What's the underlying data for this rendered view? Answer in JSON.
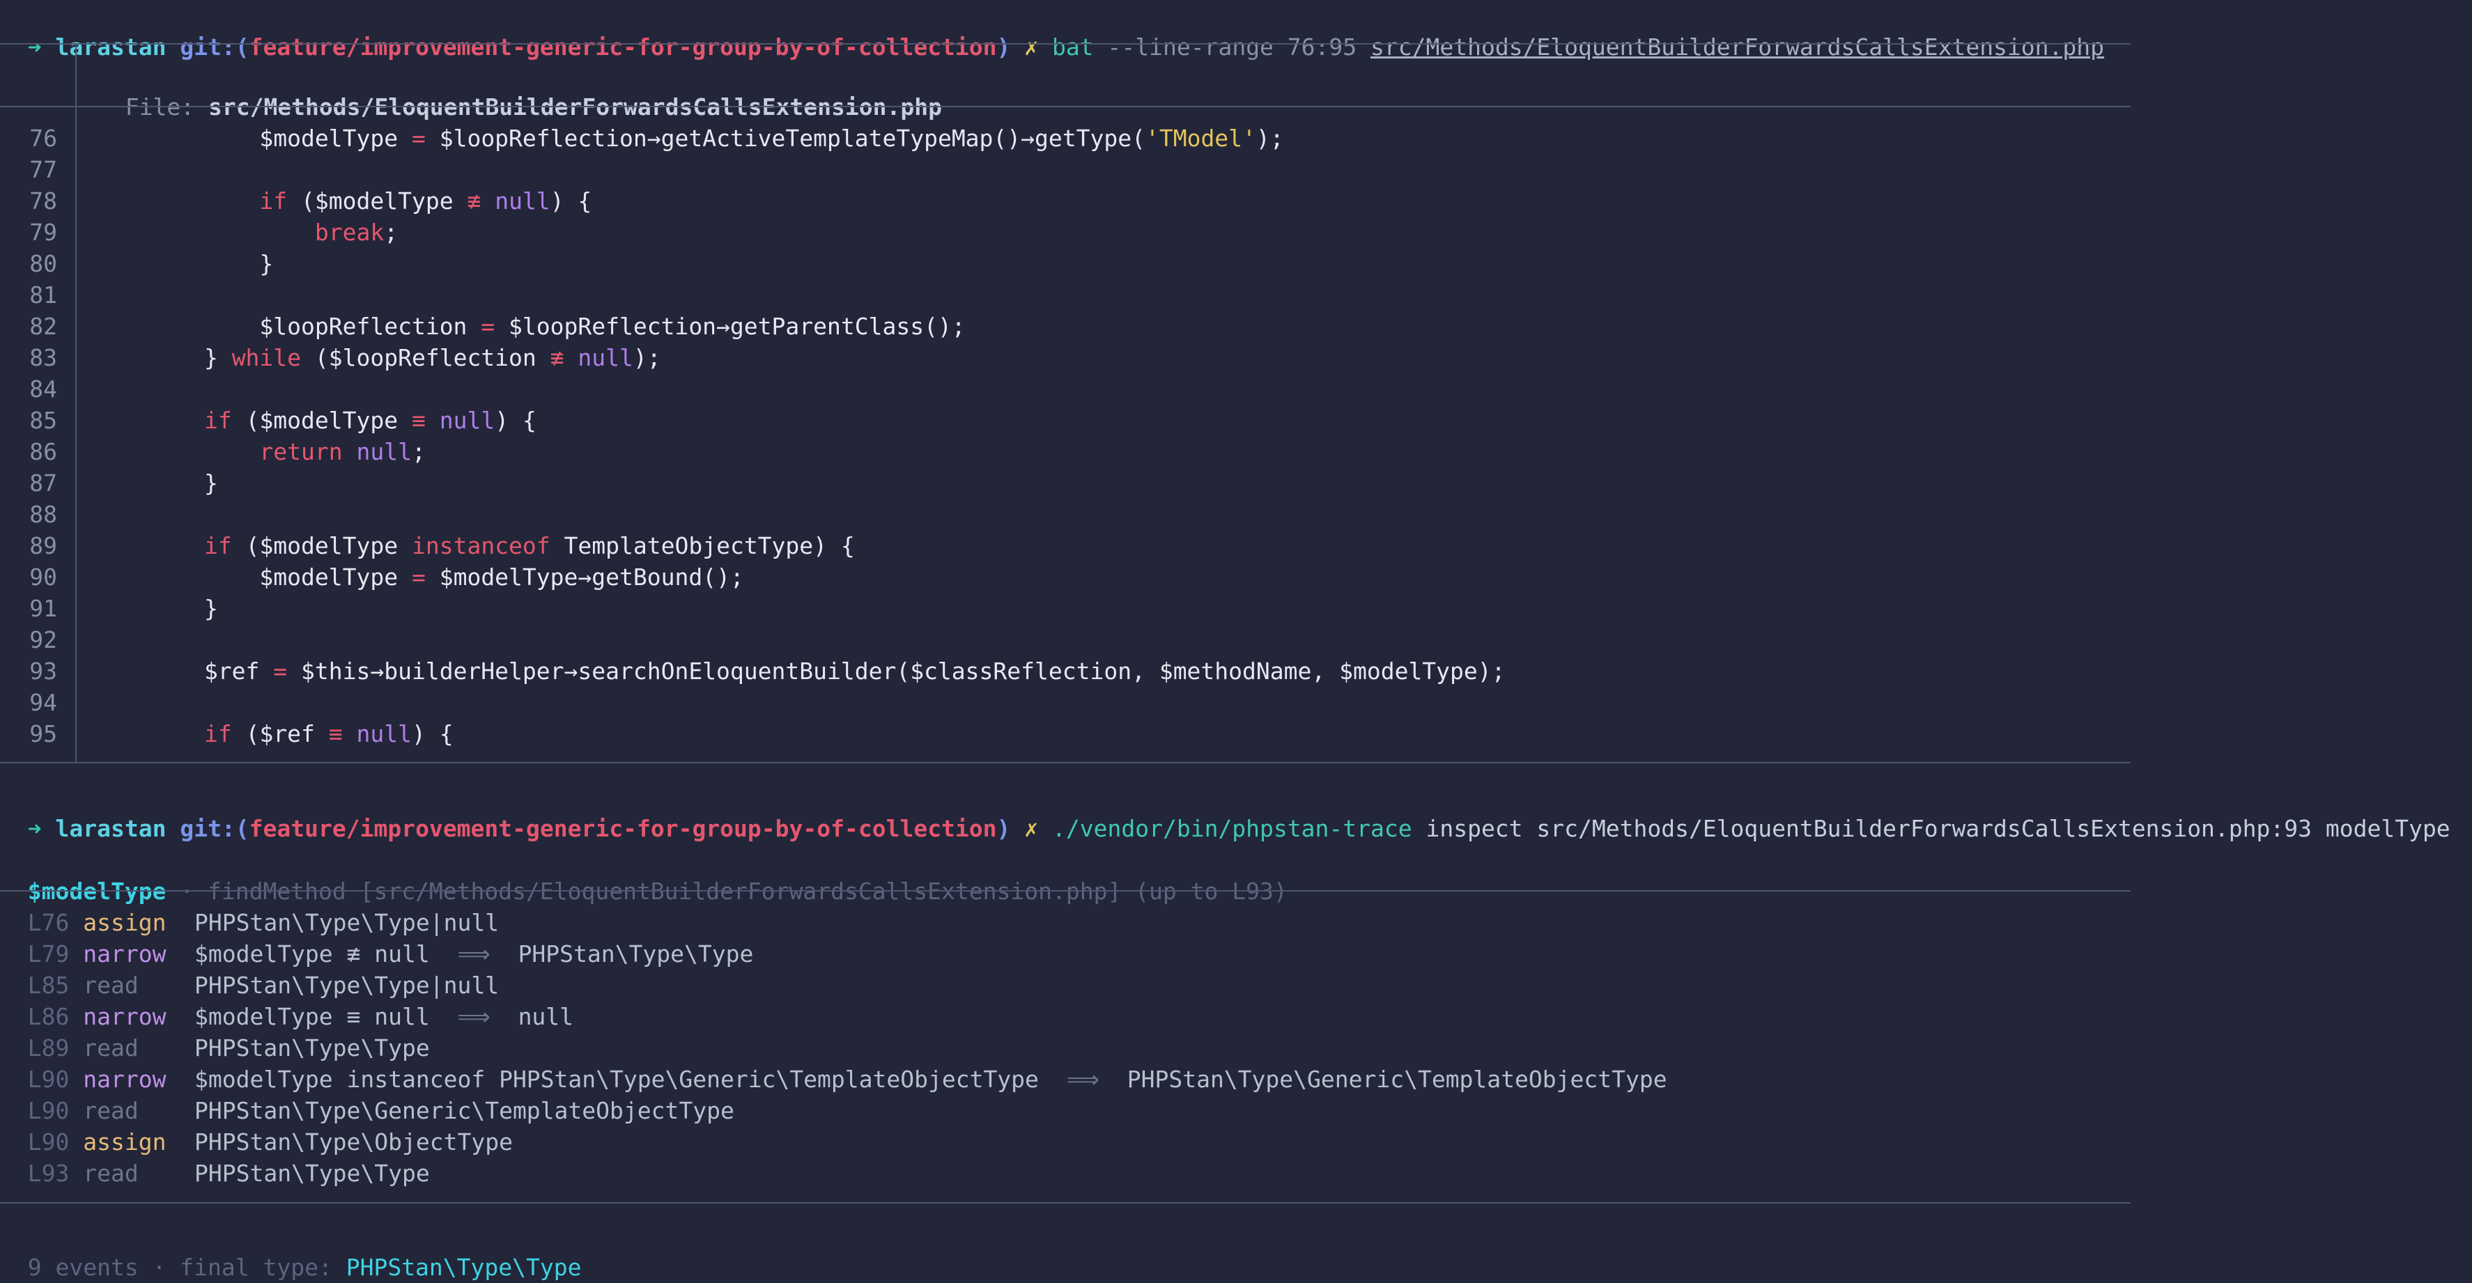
{
  "prompt1": {
    "arrow": "➜",
    "repo": "larastan",
    "git_prefix": "git:(",
    "branch": "feature/improvement-generic-for-group-by-of-collection",
    "git_suffix": ")",
    "dirty": "✗",
    "command": "bat",
    "options": "--line-range 76:95",
    "path": "src/Methods/EloquentBuilderForwardsCallsExtension.php"
  },
  "bat": {
    "file_label": "File: ",
    "file_name": "src/Methods/EloquentBuilderForwardsCallsExtension.php",
    "lines": [
      {
        "num": "76",
        "tokens": [
          {
            "t": "            $modelType ",
            "c": ""
          },
          {
            "t": "=",
            "c": "op"
          },
          {
            "t": " $loopReflection→getActiveTemplateTypeMap()→getType(",
            "c": ""
          },
          {
            "t": "'TModel'",
            "c": "str"
          },
          {
            "t": ");",
            "c": ""
          }
        ]
      },
      {
        "num": "77",
        "tokens": []
      },
      {
        "num": "78",
        "tokens": [
          {
            "t": "            ",
            "c": ""
          },
          {
            "t": "if",
            "c": "kw"
          },
          {
            "t": " ($modelType ",
            "c": ""
          },
          {
            "t": "≢",
            "c": "op"
          },
          {
            "t": " ",
            "c": ""
          },
          {
            "t": "null",
            "c": "lit"
          },
          {
            "t": ") {",
            "c": ""
          }
        ]
      },
      {
        "num": "79",
        "tokens": [
          {
            "t": "                ",
            "c": ""
          },
          {
            "t": "break",
            "c": "kw"
          },
          {
            "t": ";",
            "c": ""
          }
        ]
      },
      {
        "num": "80",
        "tokens": [
          {
            "t": "            }",
            "c": ""
          }
        ]
      },
      {
        "num": "81",
        "tokens": []
      },
      {
        "num": "82",
        "tokens": [
          {
            "t": "            $loopReflection ",
            "c": ""
          },
          {
            "t": "=",
            "c": "op"
          },
          {
            "t": " $loopReflection→getParentClass();",
            "c": ""
          }
        ]
      },
      {
        "num": "83",
        "tokens": [
          {
            "t": "        } ",
            "c": ""
          },
          {
            "t": "while",
            "c": "kw"
          },
          {
            "t": " ($loopReflection ",
            "c": ""
          },
          {
            "t": "≢",
            "c": "op"
          },
          {
            "t": " ",
            "c": ""
          },
          {
            "t": "null",
            "c": "lit"
          },
          {
            "t": ");",
            "c": ""
          }
        ]
      },
      {
        "num": "84",
        "tokens": []
      },
      {
        "num": "85",
        "tokens": [
          {
            "t": "        ",
            "c": ""
          },
          {
            "t": "if",
            "c": "kw"
          },
          {
            "t": " ($modelType ",
            "c": ""
          },
          {
            "t": "≡",
            "c": "op"
          },
          {
            "t": " ",
            "c": ""
          },
          {
            "t": "null",
            "c": "lit"
          },
          {
            "t": ") {",
            "c": ""
          }
        ]
      },
      {
        "num": "86",
        "tokens": [
          {
            "t": "            ",
            "c": ""
          },
          {
            "t": "return",
            "c": "kw"
          },
          {
            "t": " ",
            "c": ""
          },
          {
            "t": "null",
            "c": "lit"
          },
          {
            "t": ";",
            "c": ""
          }
        ]
      },
      {
        "num": "87",
        "tokens": [
          {
            "t": "        }",
            "c": ""
          }
        ]
      },
      {
        "num": "88",
        "tokens": []
      },
      {
        "num": "89",
        "tokens": [
          {
            "t": "        ",
            "c": ""
          },
          {
            "t": "if",
            "c": "kw"
          },
          {
            "t": " ($modelType ",
            "c": ""
          },
          {
            "t": "instanceof",
            "c": "kw"
          },
          {
            "t": " TemplateObjectType) {",
            "c": ""
          }
        ]
      },
      {
        "num": "90",
        "tokens": [
          {
            "t": "            $modelType ",
            "c": ""
          },
          {
            "t": "=",
            "c": "op"
          },
          {
            "t": " $modelType→getBound();",
            "c": ""
          }
        ]
      },
      {
        "num": "91",
        "tokens": [
          {
            "t": "        }",
            "c": ""
          }
        ]
      },
      {
        "num": "92",
        "tokens": []
      },
      {
        "num": "93",
        "tokens": [
          {
            "t": "        $ref ",
            "c": ""
          },
          {
            "t": "=",
            "c": "op"
          },
          {
            "t": " $this→builderHelper→searchOnEloquentBuilder($classReflection, $methodName, $modelType);",
            "c": ""
          }
        ]
      },
      {
        "num": "94",
        "tokens": []
      },
      {
        "num": "95",
        "tokens": [
          {
            "t": "        ",
            "c": ""
          },
          {
            "t": "if",
            "c": "kw"
          },
          {
            "t": " ($ref ",
            "c": ""
          },
          {
            "t": "≡",
            "c": "op"
          },
          {
            "t": " ",
            "c": ""
          },
          {
            "t": "null",
            "c": "lit"
          },
          {
            "t": ") {",
            "c": ""
          }
        ]
      }
    ]
  },
  "prompt2": {
    "arrow": "➜",
    "repo": "larastan",
    "git_prefix": "git:(",
    "branch": "feature/improvement-generic-for-group-by-of-collection",
    "git_suffix": ")",
    "dirty": "✗",
    "command": "./vendor/bin/phpstan-trace",
    "args": "inspect src/Methods/EloquentBuilderForwardsCallsExtension.php:93 modelType"
  },
  "trace": {
    "variable": "$modelType",
    "context": " · findMethod [src/Methods/EloquentBuilderForwardsCallsExtension.php] (up to L93)",
    "events": [
      {
        "line": "L76",
        "kind": "assign",
        "text": "PHPStan\\Type\\Type|null",
        "arrow": "",
        "result": ""
      },
      {
        "line": "L79",
        "kind": "narrow",
        "text": "$modelType ≢ null",
        "arrow": "⟹",
        "result": "PHPStan\\Type\\Type"
      },
      {
        "line": "L85",
        "kind": "read",
        "text": "PHPStan\\Type\\Type|null",
        "arrow": "",
        "result": ""
      },
      {
        "line": "L86",
        "kind": "narrow",
        "text": "$modelType ≡ null",
        "arrow": "⟹",
        "result": "null"
      },
      {
        "line": "L89",
        "kind": "read",
        "text": "PHPStan\\Type\\Type",
        "arrow": "",
        "result": ""
      },
      {
        "line": "L90",
        "kind": "narrow",
        "text": "$modelType instanceof PHPStan\\Type\\Generic\\TemplateObjectType",
        "arrow": "⟹",
        "result": "PHPStan\\Type\\Generic\\TemplateObjectType"
      },
      {
        "line": "L90",
        "kind": "read",
        "text": "PHPStan\\Type\\Generic\\TemplateObjectType",
        "arrow": "",
        "result": ""
      },
      {
        "line": "L90",
        "kind": "assign",
        "text": "PHPStan\\Type\\ObjectType",
        "arrow": "",
        "result": ""
      },
      {
        "line": "L93",
        "kind": "read",
        "text": "PHPStan\\Type\\Type",
        "arrow": "",
        "result": ""
      }
    ],
    "summary_prefix": "9 events · final type: ",
    "final_type": "PHPStan\\Type\\Type"
  }
}
